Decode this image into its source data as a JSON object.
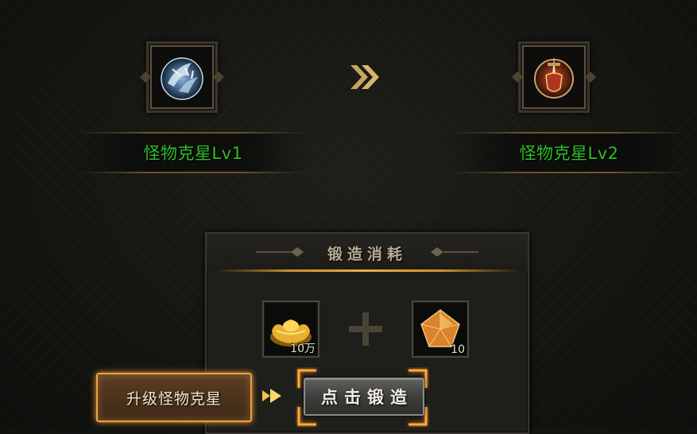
{
  "skills": {
    "current": {
      "name": "怪物克星Lv1",
      "icon": "blue-beast-claw-skill-icon"
    },
    "next": {
      "name": "怪物克星Lv2",
      "icon": "red-shield-sword-skill-icon"
    },
    "transition_icon": "double-chevron-right-icon"
  },
  "forge_cost": {
    "title": "锻造消耗",
    "items": [
      {
        "icon": "gold-ingot-icon",
        "quantity": "10万"
      },
      {
        "icon": "amber-pentagon-gem-icon",
        "quantity": "10"
      }
    ],
    "separator_icon": "plus-icon"
  },
  "actions": {
    "upgrade_tab_label": "升级怪物克星",
    "forge_button_label": "点击锻造",
    "pointer_icon": "double-arrow-right-icon"
  },
  "colors": {
    "skill_name": "#2fbf2a",
    "accent_gold": "#e3b040",
    "tab_glow": "#e8a24a"
  }
}
